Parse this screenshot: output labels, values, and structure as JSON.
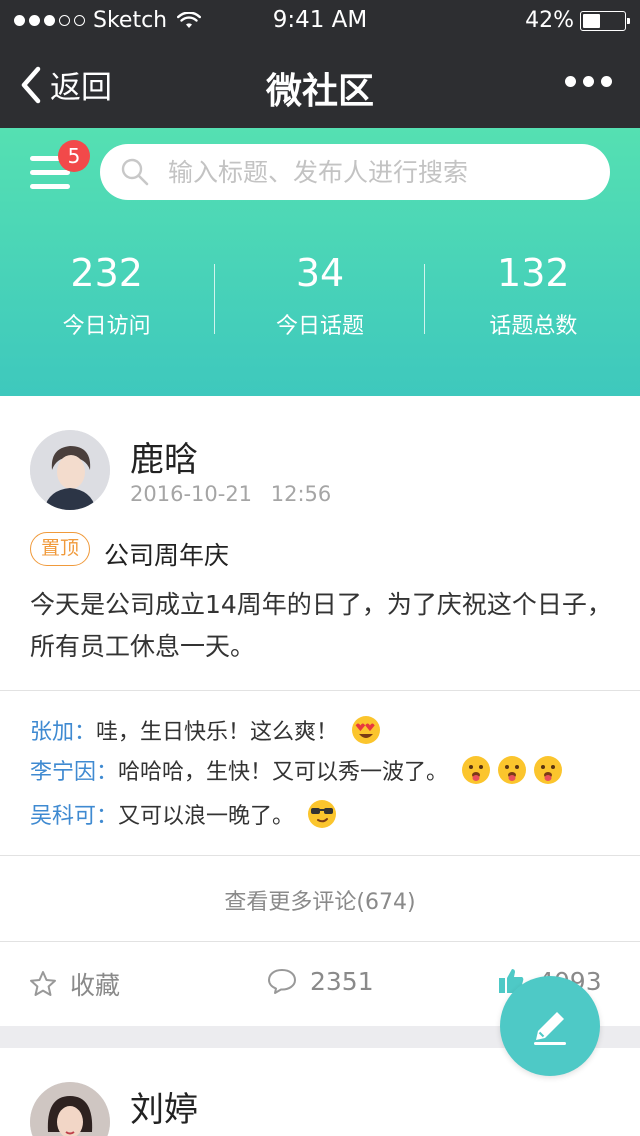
{
  "status_bar": {
    "carrier": "Sketch",
    "time": "9:41 AM",
    "battery_percent": "42%",
    "battery_level": 0.42,
    "signal_bars": 3,
    "signal_total": 5
  },
  "nav": {
    "back_label": "返回",
    "title": "微社区",
    "more_icon": "more-dots-icon"
  },
  "header": {
    "menu_icon": "hamburger-menu-icon",
    "notification_count": "5",
    "search_placeholder": "输入标题、发布人进行搜索",
    "stats": [
      {
        "value": "232",
        "label": "今日访问"
      },
      {
        "value": "34",
        "label": "今日话题"
      },
      {
        "value": "132",
        "label": "话题总数"
      }
    ]
  },
  "posts": [
    {
      "author": "鹿晗",
      "date": "2016-10-21",
      "time": "12:56",
      "tag": "置顶",
      "title": "公司周年庆",
      "body": "今天是公司成立14周年的日了，为了庆祝这个日子，所有员工休息一天。",
      "comments": [
        {
          "name": "张加：",
          "text": "哇，生日快乐！这么爽！",
          "emojis": [
            "heart-eyes-emoji"
          ]
        },
        {
          "name": "李宁因：",
          "text": "哈哈哈，生快！又可以秀一波了。",
          "emojis": [
            "tongue-emoji",
            "tongue-emoji",
            "tongue-emoji"
          ]
        },
        {
          "name": "吴科可：",
          "text": "又可以浪一晚了。",
          "emojis": [
            "sunglasses-emoji"
          ]
        }
      ],
      "more_comments": "查看更多评论(674)",
      "actions": {
        "favorite_label": "收藏",
        "comment_count": "2351",
        "like_count": "4093"
      }
    },
    {
      "author": "刘婷"
    }
  ],
  "fab": {
    "icon": "pencil-icon"
  },
  "colors": {
    "nav_bg": "#2d2e31",
    "gradient_top": "#55e0b2",
    "gradient_bottom": "#3ec8bd",
    "badge": "#f2494a",
    "tag": "#f09a3b",
    "comment_name": "#3f8ad1",
    "fab": "#4ec9c6"
  }
}
